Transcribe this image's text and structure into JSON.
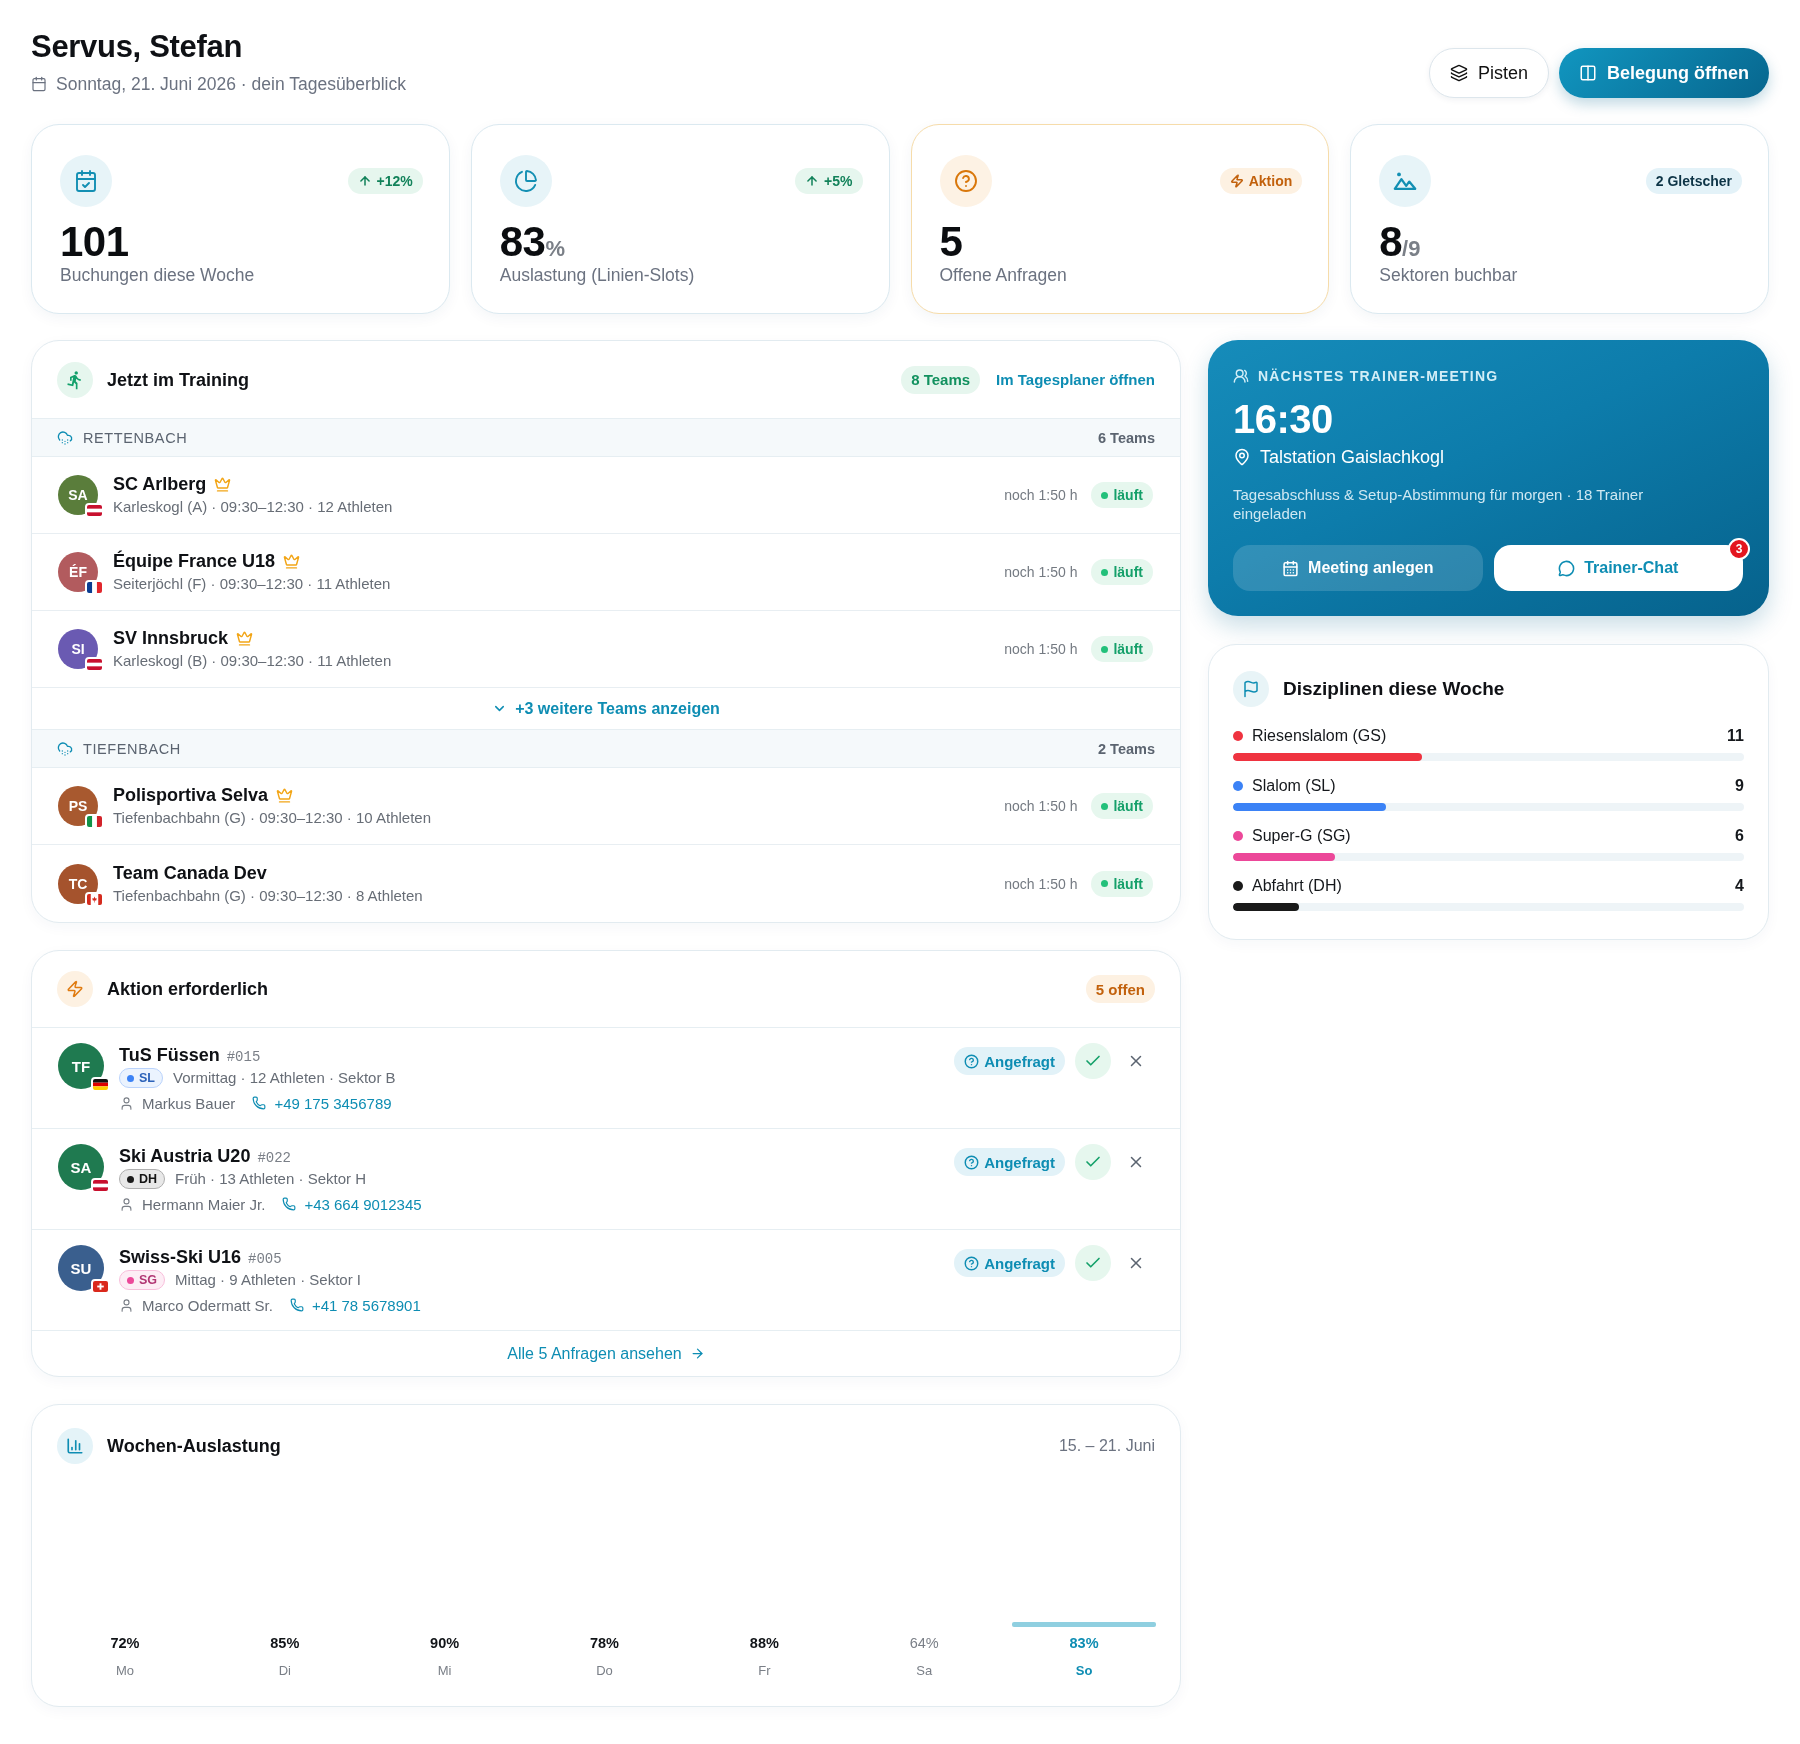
{
  "header": {
    "title": "Servus, Stefan",
    "subtitle": "Sonntag, 21. Juni 2026 · dein Tagesüberblick",
    "actions": [
      {
        "label": "Pisten",
        "kind": "secondary"
      },
      {
        "label": "Belegung öffnen",
        "kind": "primary"
      }
    ]
  },
  "stats": [
    {
      "kind": "bookings",
      "badge": {
        "text": "+12%",
        "kind": "trend"
      },
      "value": "101",
      "label": "Buchungen diese Woche"
    },
    {
      "kind": "utilization",
      "badge": {
        "text": "+5%",
        "kind": "trend"
      },
      "value": "83",
      "unit": "%",
      "label": "Auslastung (Linien-Slots)"
    },
    {
      "kind": "requests",
      "badge": {
        "text": "Aktion",
        "kind": "alert"
      },
      "value": "5",
      "label": "Offene Anfragen"
    },
    {
      "kind": "sectors",
      "badge": {
        "text": "2 Gletscher",
        "kind": "info"
      },
      "value": "8",
      "unit": "/9",
      "label": "Sektoren buchbar"
    }
  ],
  "training": {
    "title": "Jetzt im Training",
    "count": "8 Teams",
    "link": "Im Tagesplaner öffnen",
    "groups": [
      {
        "name": "RETTENBACH",
        "count": "6 Teams",
        "teams": [
          {
            "initials": "SA",
            "color": "#5a7d3b",
            "flag": {
              "kind": "at"
            },
            "name": "SC Arlberg",
            "premium": true,
            "meta": "Karleskogl (A) · 09:30–12:30 · 12 Athleten",
            "remaining": "noch 1:50 h",
            "status": {
              "label": "läuft",
              "kind": "running"
            }
          },
          {
            "initials": "ÉF",
            "color": "#b25b5e",
            "flag": {
              "kind": "fr"
            },
            "name": "Équipe France U18",
            "premium": true,
            "meta": "Seiterjöchl (F) · 09:30–12:30 · 11 Athleten",
            "remaining": "noch 1:50 h",
            "status": {
              "label": "läuft",
              "kind": "running"
            }
          },
          {
            "initials": "SI",
            "color": "#6a5ab2",
            "flag": {
              "kind": "at"
            },
            "name": "SV Innsbruck",
            "premium": true,
            "meta": "Karleskogl (B) · 09:30–12:30 · 11 Athleten",
            "remaining": "noch 1:50 h",
            "status": {
              "label": "läuft",
              "kind": "running"
            }
          }
        ],
        "more": "+3 weitere Teams anzeigen"
      },
      {
        "name": "TIEFENBACH",
        "count": "2 Teams",
        "teams": [
          {
            "initials": "PS",
            "color": "#a8592f",
            "flag": {
              "kind": "it"
            },
            "name": "Polisportiva Selva",
            "premium": true,
            "meta": "Tiefenbachbahn (G) · 09:30–12:30 · 10 Athleten",
            "remaining": "noch 1:50 h",
            "status": {
              "label": "läuft",
              "kind": "running"
            }
          },
          {
            "initials": "TC",
            "color": "#a5532d",
            "flag": {
              "kind": "ca"
            },
            "name": "Team Canada Dev",
            "premium": false,
            "meta": "Tiefenbachbahn (G) · 09:30–12:30 · 8 Athleten",
            "remaining": "noch 1:50 h",
            "status": {
              "label": "läuft",
              "kind": "running"
            }
          }
        ]
      }
    ]
  },
  "meeting": {
    "eyebrow": "NÄCHSTES TRAINER-MEETING",
    "time": "16:30",
    "location": "Talstation Gaislachkogl",
    "description": "Tagesabschluss & Setup-Abstimmung für morgen · 18 Trainer eingeladen",
    "actions": [
      {
        "label": "Meeting anlegen",
        "kind": "ghost"
      },
      {
        "label": "Trainer-Chat",
        "kind": "solid",
        "badge": "3"
      }
    ]
  },
  "disciplines": {
    "title": "Disziplinen diese Woche",
    "items": [
      {
        "name": "Riesenslalom (GS)",
        "count": "11",
        "color": "#ef3340",
        "level": 0.37
      },
      {
        "name": "Slalom (SL)",
        "count": "9",
        "color": "#3b82f6",
        "level": 0.3
      },
      {
        "name": "Super-G (SG)",
        "count": "6",
        "color": "#ec4899",
        "level": 0.2
      },
      {
        "name": "Abfahrt (DH)",
        "count": "4",
        "color": "#1a1a1a",
        "level": 0.13
      }
    ]
  },
  "requests": {
    "title": "Aktion erforderlich",
    "count": "5 offen",
    "items": [
      {
        "initials": "TF",
        "color": "#1f7a50",
        "flag": {
          "kind": "de"
        },
        "name": "TuS Füssen",
        "ref": "#015",
        "discipline": {
          "code": "SL",
          "color": "#3b82f6"
        },
        "details": "Vormittag · 12 Athleten · Sektor B",
        "contact": "Markus Bauer",
        "phone": "+49 175 3456789",
        "status": {
          "label": "Angefragt",
          "kind": "requested"
        }
      },
      {
        "initials": "SA",
        "color": "#1f7a50",
        "flag": {
          "kind": "at"
        },
        "name": "Ski Austria U20",
        "ref": "#022",
        "discipline": {
          "code": "DH",
          "color": "#1a1a1a"
        },
        "details": "Früh · 13 Athleten · Sektor H",
        "contact": "Hermann Maier Jr.",
        "phone": "+43 664 9012345",
        "status": {
          "label": "Angefragt",
          "kind": "requested"
        }
      },
      {
        "initials": "SU",
        "color": "#3a5f8e",
        "flag": {
          "kind": "ch"
        },
        "name": "Swiss-Ski U16",
        "ref": "#005",
        "discipline": {
          "code": "SG",
          "color": "#ec4899"
        },
        "details": "Mittag · 9 Athleten · Sektor I",
        "contact": "Marco Odermatt Sr.",
        "phone": "+41 78 5678901",
        "status": {
          "label": "Angefragt",
          "kind": "requested"
        }
      }
    ],
    "footer": "Alle 5 Anfragen ansehen"
  },
  "weekly": {
    "title": "Wochen-Auslastung",
    "range": "15. – 21. Juni",
    "days": [
      {
        "value": "72%",
        "label": "Mo",
        "selected": false,
        "muted": false
      },
      {
        "value": "85%",
        "label": "Di",
        "selected": false,
        "muted": false
      },
      {
        "value": "90%",
        "label": "Mi",
        "selected": false,
        "muted": false
      },
      {
        "value": "78%",
        "label": "Do",
        "selected": false,
        "muted": false
      },
      {
        "value": "88%",
        "label": "Fr",
        "selected": false,
        "muted": false
      },
      {
        "value": "64%",
        "label": "Sa",
        "selected": false,
        "muted": true
      },
      {
        "value": "83%",
        "label": "So",
        "selected": true,
        "muted": false
      }
    ]
  }
}
